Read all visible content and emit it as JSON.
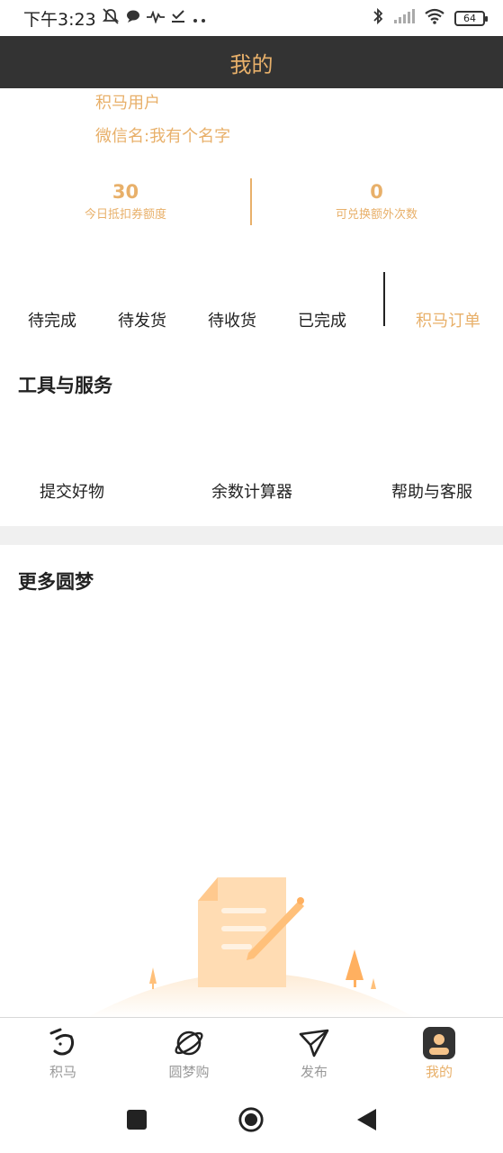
{
  "status_bar": {
    "time": "下午3:23",
    "battery": "64"
  },
  "header": {
    "title": "我的"
  },
  "profile": {
    "name": "积马用户",
    "wechat": "微信名:我有个名字"
  },
  "stats": {
    "left_value": "30",
    "left_label": "今日抵扣券额度",
    "right_value": "0",
    "right_label": "可兑换额外次数"
  },
  "orders": {
    "items": [
      "待完成",
      "待发货",
      "待收货",
      "已完成"
    ],
    "link": "积马订单"
  },
  "tools": {
    "title": "工具与服务",
    "items": [
      "提交好物",
      "余数计算器",
      "帮助与客服"
    ]
  },
  "more": {
    "title": "更多圆梦"
  },
  "bottom_nav": {
    "tabs": [
      "积马",
      "圆梦购",
      "发布",
      "我的"
    ],
    "active_index": 3
  },
  "colors": {
    "accent": "#e8b06a",
    "header_bg": "#333333"
  }
}
